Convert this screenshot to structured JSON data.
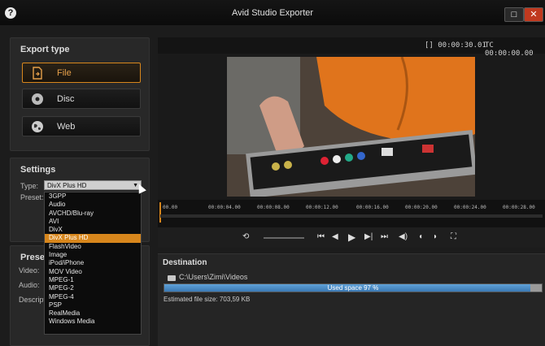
{
  "window": {
    "title": "Avid Studio Exporter",
    "help_icon": "?",
    "maximize_icon": "□",
    "close_icon": "✕"
  },
  "export_type": {
    "heading": "Export type",
    "options": [
      {
        "label": "File",
        "icon": "file-icon",
        "active": true
      },
      {
        "label": "Disc",
        "icon": "disc-icon",
        "active": false
      },
      {
        "label": "Web",
        "icon": "globe-icon",
        "active": false
      }
    ]
  },
  "settings": {
    "heading": "Settings",
    "type_label": "Type:",
    "preset_label": "Preset:",
    "selected_type": "DivX Plus HD",
    "type_options": [
      "3GPP",
      "Audio",
      "AVCHD/Blu-ray",
      "AVI",
      "DivX",
      "DivX Plus HD",
      "FlashVideo",
      "Image",
      "iPod/iPhone",
      "MOV Video",
      "MPEG-1",
      "MPEG-2",
      "MPEG-4",
      "PSP",
      "RealMedia",
      "Windows Media"
    ]
  },
  "preset": {
    "heading": "Preset",
    "video_label": "Video:",
    "audio_label": "Audio:",
    "description_label": "Descript"
  },
  "player": {
    "timecode_left": "[] 00:00:30.01",
    "timecode_right": "TC 00:00:00.00",
    "ticks": [
      "00.00",
      "00:00:04.00",
      "00:00:08.00",
      "00:00:12.00",
      "00:00:16.00",
      "00:00:20.00",
      "00:00:24.00",
      "00:00:28.00"
    ],
    "controls": [
      "⟲",
      "⏮",
      "◀",
      "▶",
      "▶|",
      "⏭",
      "◀)",
      "◖",
      "◗",
      "⛶"
    ]
  },
  "destination": {
    "heading": "Destination",
    "path": "C:\\Users\\Zimi\\Videos",
    "used_text": "Used space 97 %",
    "used_fraction": 0.97,
    "estimated_size": "Estimated file size: 703,59 KB"
  },
  "colors": {
    "accent": "#d7861c",
    "progress": "#3b79b4"
  }
}
